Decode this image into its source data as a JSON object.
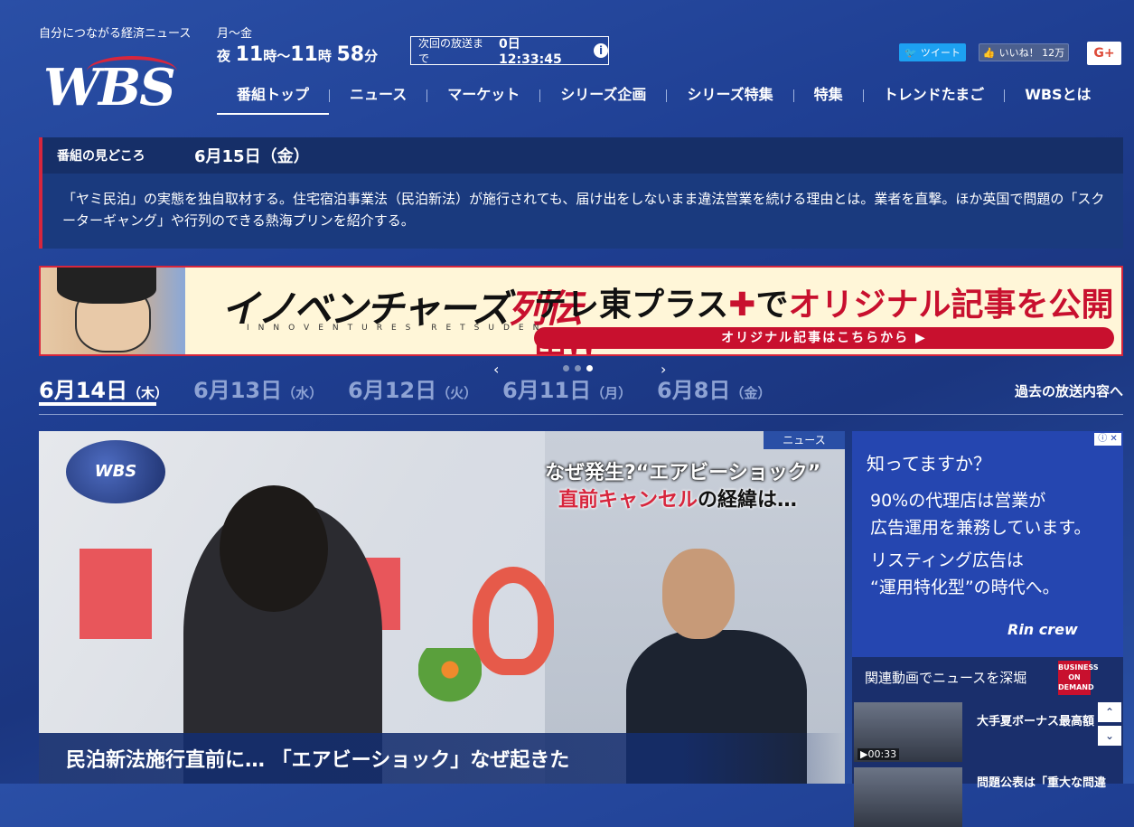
{
  "header": {
    "tagline": "自分につながる経済ニュース",
    "logo": "WBS",
    "schedule_days": "月～金",
    "time_prefix": "夜",
    "time_start_h": "11",
    "time_unit_h": "時",
    "time_sep": "～",
    "time_end_h": "11",
    "time_end_m": "58",
    "time_unit_m": "分",
    "countdown_label": "次回の放送まで",
    "countdown_value": "0日 12:33:45",
    "info_icon": "i",
    "tweet": "ツイート",
    "like": "いいね！ 12万",
    "gplus": "G+"
  },
  "nav": {
    "items": [
      "番組トップ",
      "ニュース",
      "マーケット",
      "シリーズ企画",
      "シリーズ特集",
      "特集",
      "トレンドたまご",
      "WBSとは"
    ]
  },
  "highlight": {
    "label": "番組の見どころ",
    "date": "6月15日（金）",
    "text": "「ヤミ民泊」の実態を独自取材する。住宅宿泊事業法（民泊新法）が施行されても、届け出をしないまま違法営業を続ける理由とは。業者を直撃。ほか英国で問題の「スクーターギャング」や行列のできる熱海プリンを紹介する。"
  },
  "banner": {
    "title_a": "イノベンチャーズ",
    "title_b": "列伝",
    "title_sub": "INNOVENTURES RETSUDEN",
    "plus_a": "テレ東プラス",
    "plus_b": "で",
    "plus_c": "オリジナル記事を公開中!!",
    "cta": "オリジナル記事はこちらから ▶"
  },
  "carousel": {
    "prev": "‹",
    "next": "›"
  },
  "dates": [
    {
      "d": "6月14日",
      "s": "（木）",
      "active": true
    },
    {
      "d": "6月13日",
      "s": "（水）",
      "active": false
    },
    {
      "d": "6月12日",
      "s": "（火）",
      "active": false
    },
    {
      "d": "6月11日",
      "s": "（月）",
      "active": false
    },
    {
      "d": "6月8日",
      "s": "（金）",
      "active": false
    }
  ],
  "past_link": "過去の放送内容へ",
  "hero": {
    "badge": "ニュース",
    "logo": "WBS",
    "caption1": "なぜ発生?“エアビーショック”",
    "caption2a": "直前キャンセル",
    "caption2b": "の経緯は…",
    "title": "民泊新法施行直前に… 「エアビーショック」なぜ起きた"
  },
  "ad": {
    "line1": "知ってますか？",
    "line2a": "90%の代理店は営業が",
    "line2b": "広告運用を兼務しています。",
    "line3a": "リスティング広告は",
    "line3b": "“運用特化型”の時代へ。",
    "brand": "Rin crew",
    "adchoices": "ⓘ ✕"
  },
  "related": {
    "heading": "関連動画でニュースを深堀",
    "od_badge": "BUSINESS ON DEMAND",
    "items": [
      {
        "duration": "▶00:33",
        "title": "大手夏ボーナス最高額"
      },
      {
        "duration": "",
        "title": "問題公表は「重大な問違"
      }
    ],
    "scroll_up": "⌃",
    "scroll_down": "⌄"
  }
}
